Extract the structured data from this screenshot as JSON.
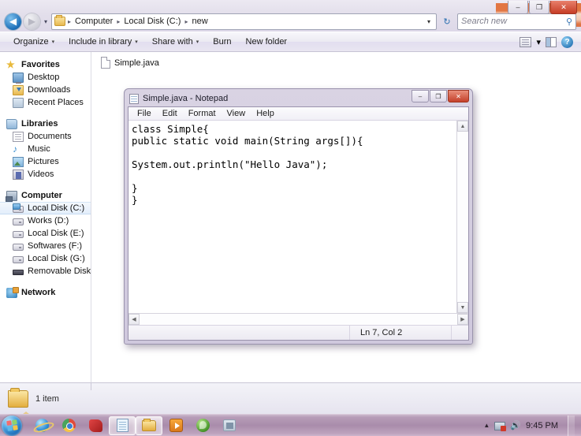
{
  "explorer": {
    "breadcrumb": [
      "Computer",
      "Local Disk (C:)",
      "new"
    ],
    "search": {
      "placeholder": "Search new"
    },
    "commands": [
      {
        "label": "Organize",
        "caret": "▾"
      },
      {
        "label": "Include in library",
        "caret": "▾"
      },
      {
        "label": "Share with",
        "caret": "▾"
      },
      {
        "label": "Burn",
        "caret": ""
      },
      {
        "label": "New folder",
        "caret": ""
      }
    ],
    "window_buttons": {
      "minimize": "–",
      "maximize": "❐",
      "close": "✕"
    },
    "nav_back": "◀",
    "nav_forward": "▶",
    "nav_caret": "▾",
    "address_caret": "▾",
    "refresh": "↻",
    "search_icon": "⚲",
    "view_caret": "▾",
    "help_label": "?",
    "sidebar": [
      {
        "label": "Favorites",
        "icon": "star-icon",
        "head": true,
        "selected": false
      },
      {
        "label": "Desktop",
        "icon": "desktop-icon",
        "head": false,
        "selected": false
      },
      {
        "label": "Downloads",
        "icon": "downloads-icon",
        "head": false,
        "selected": false
      },
      {
        "label": "Recent Places",
        "icon": "recent-places-icon",
        "head": false,
        "selected": false
      },
      {
        "label": "Libraries",
        "icon": "libraries-icon",
        "head": true,
        "selected": false
      },
      {
        "label": "Documents",
        "icon": "documents-icon",
        "head": false,
        "selected": false
      },
      {
        "label": "Music",
        "icon": "music-icon",
        "head": false,
        "selected": false
      },
      {
        "label": "Pictures",
        "icon": "pictures-icon",
        "head": false,
        "selected": false
      },
      {
        "label": "Videos",
        "icon": "videos-icon",
        "head": false,
        "selected": false
      },
      {
        "label": "Computer",
        "icon": "computer-icon",
        "head": true,
        "selected": false
      },
      {
        "label": "Local Disk (C:)",
        "icon": "system-drive-icon",
        "head": false,
        "selected": true
      },
      {
        "label": "Works (D:)",
        "icon": "drive-icon",
        "head": false,
        "selected": false
      },
      {
        "label": "Local Disk (E:)",
        "icon": "drive-icon",
        "head": false,
        "selected": false
      },
      {
        "label": "Softwares (F:)",
        "icon": "drive-icon",
        "head": false,
        "selected": false
      },
      {
        "label": "Local Disk (G:)",
        "icon": "drive-icon",
        "head": false,
        "selected": false
      },
      {
        "label": "Removable Disk (I:)",
        "icon": "removable-drive-icon",
        "head": false,
        "selected": false
      },
      {
        "label": "Network",
        "icon": "network-icon",
        "head": true,
        "selected": false
      }
    ],
    "files": [
      {
        "name": "Simple.java"
      }
    ],
    "status": {
      "item_count": "1 item"
    }
  },
  "notepad": {
    "title": "Simple.java - Notepad",
    "menus": [
      "File",
      "Edit",
      "Format",
      "View",
      "Help"
    ],
    "window_buttons": {
      "minimize": "–",
      "maximize": "❐",
      "close": "✕"
    },
    "content": "class Simple{\npublic static void main(String args[]){\n\nSystem.out.println(\"Hello Java\");\n\n}\n}",
    "status": {
      "position": "Ln 7, Col 2"
    },
    "scroll": {
      "up": "▲",
      "down": "▼",
      "left": "◀",
      "right": "▶"
    }
  },
  "taskbar": {
    "start_label": "Start",
    "items": [
      {
        "name": "internet-explorer",
        "active": false
      },
      {
        "name": "google-chrome",
        "active": false
      },
      {
        "name": "pdf-reader",
        "active": false
      },
      {
        "name": "notepad",
        "active": true
      },
      {
        "name": "windows-explorer",
        "active": true
      },
      {
        "name": "media-player",
        "active": false
      },
      {
        "name": "antivirus",
        "active": false
      },
      {
        "name": "utility-app",
        "active": false
      }
    ],
    "tray": {
      "caret": "▲",
      "volume": "🔊",
      "clock": "9:45 PM"
    }
  },
  "colors": {
    "accent": "#e2703a",
    "taskbar": "#a98cab",
    "selection": "#e3eefb",
    "close_button": "#c63d26"
  }
}
